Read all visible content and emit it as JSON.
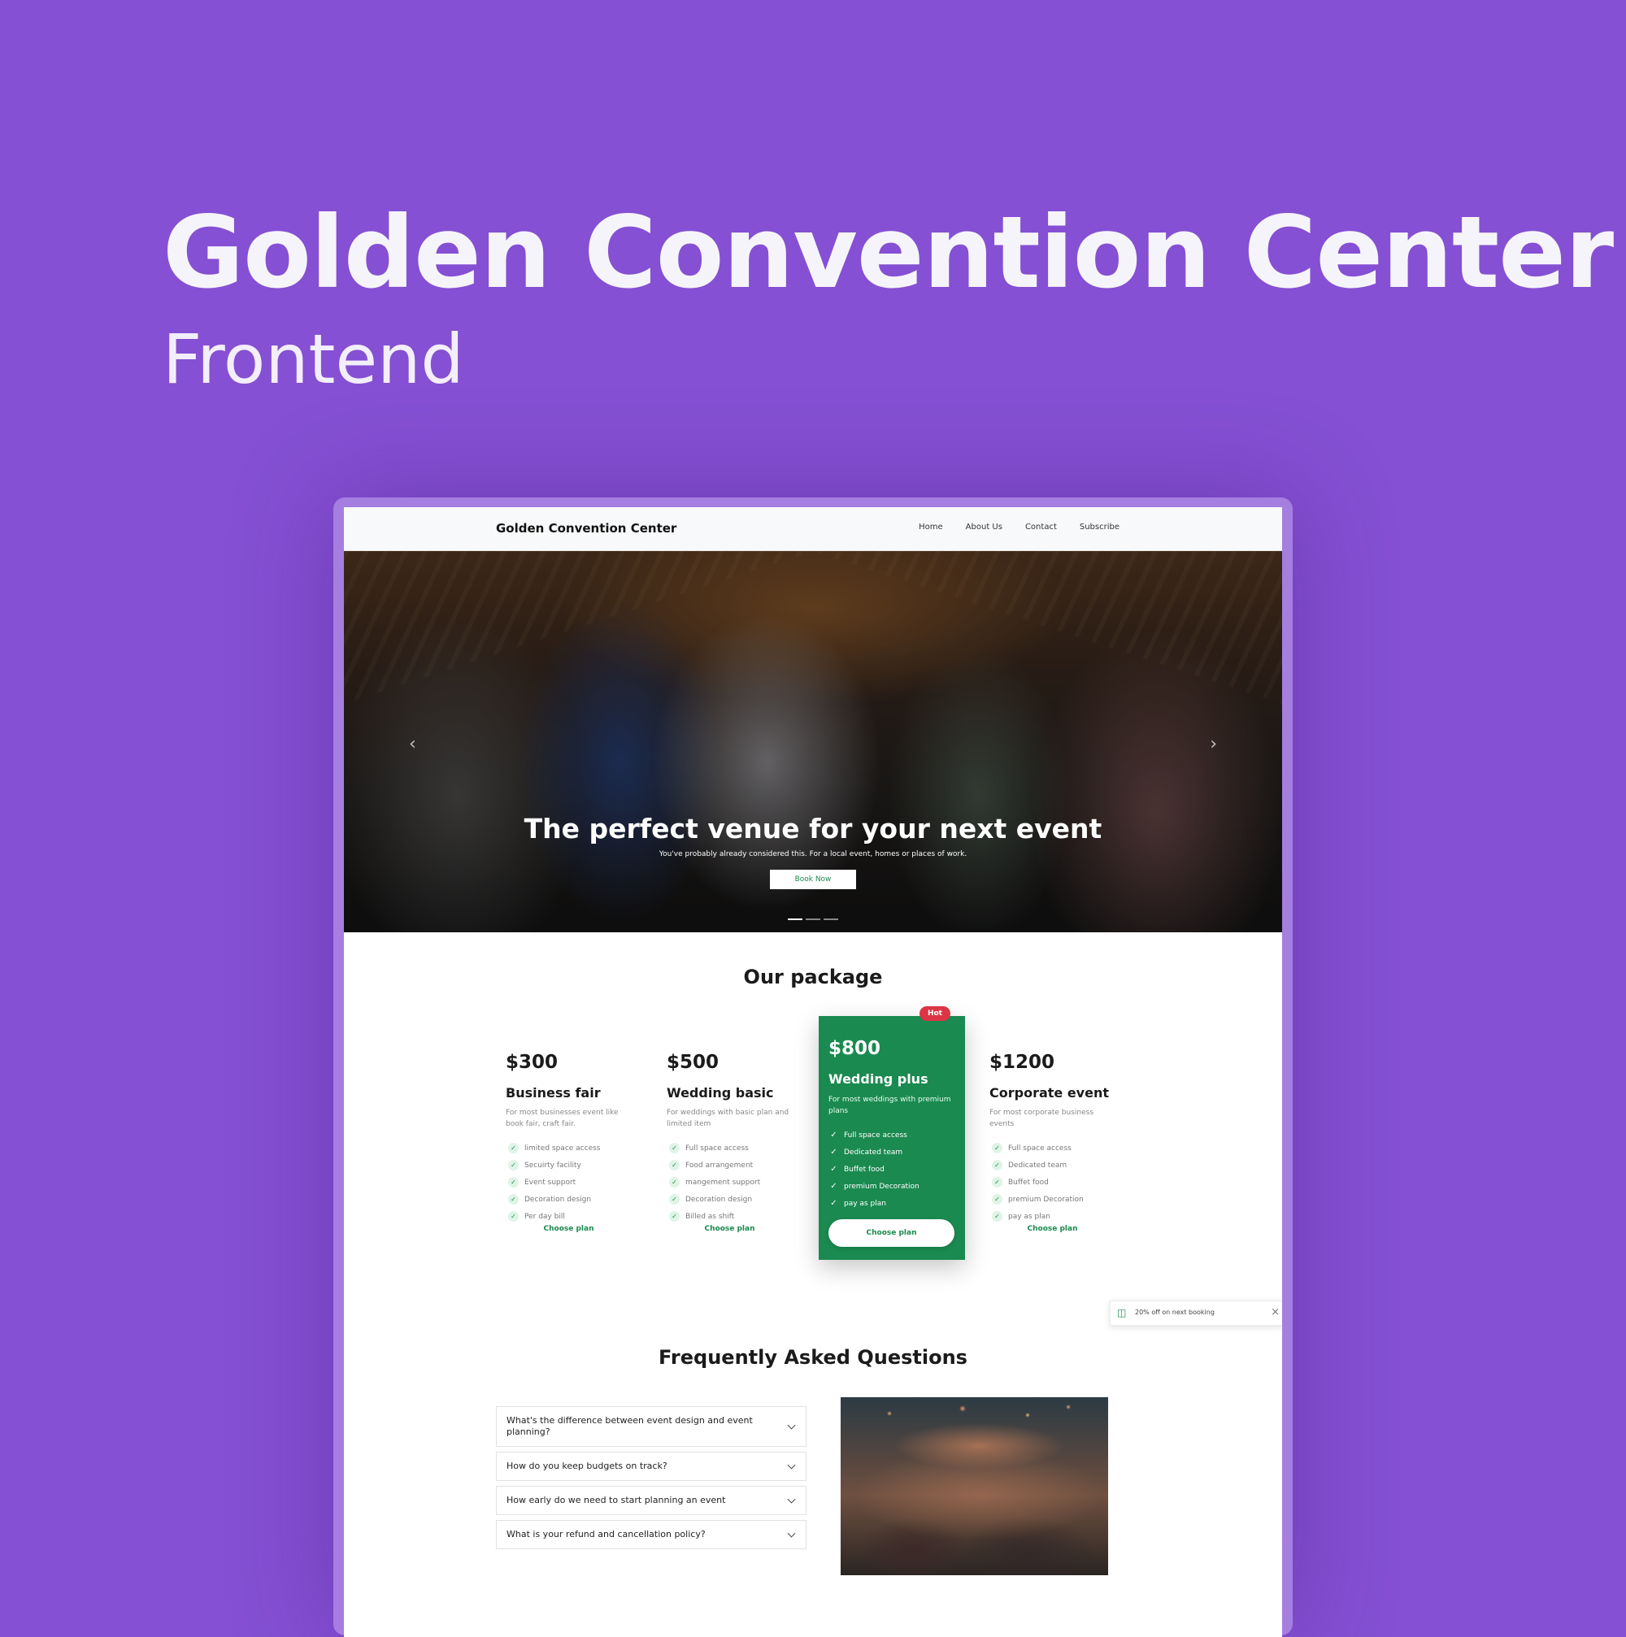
{
  "promo": {
    "title": "Golden Convention Center",
    "subtitle": "Frontend"
  },
  "nav": {
    "brand": "Golden Convention Center",
    "links": [
      "Home",
      "About Us",
      "Contact",
      "Subscribe"
    ]
  },
  "hero": {
    "title": "The perfect venue for your next event",
    "text": "You've probably already considered this. For a local event, homes or places of work.",
    "button": "Book Now",
    "slide_count": 3,
    "active_slide": 1
  },
  "packages": {
    "title": "Our package",
    "items": [
      {
        "price": "$300",
        "name": "Business fair",
        "desc": "For most businesses event like book fair, craft fair.",
        "features": [
          "limited space access",
          "Secuirty facility",
          "Event support",
          "Decoration design",
          "Per day bill"
        ],
        "cta": "Choose plan"
      },
      {
        "price": "$500",
        "name": "Wedding basic",
        "desc": "For weddings with basic plan and limited item",
        "features": [
          "Full space access",
          "Food arrangement",
          "mangement support",
          "Decoration design",
          "Billed as shift"
        ],
        "cta": "Choose plan"
      },
      {
        "price": "$800",
        "name": "Wedding plus",
        "desc": "For most weddings with premium plans",
        "features": [
          "Full space access",
          "Dedicated team",
          "Buffet food",
          "premium Decoration",
          "pay as plan"
        ],
        "cta": "Choose plan",
        "badge": "Hot"
      },
      {
        "price": "$1200",
        "name": "Corporate event",
        "desc": "For most corporate business events",
        "features": [
          "Full space access",
          "Dedicated team",
          "Buffet food",
          "premium Decoration",
          "pay as plan"
        ],
        "cta": "Choose plan"
      }
    ]
  },
  "toast": {
    "text": "20% off on next booking"
  },
  "faq": {
    "title": "Frequently Asked Questions",
    "items": [
      "What's the difference between event design and event planning?",
      "How do you keep budgets on track?",
      "How early do we need to start planning an event",
      "What is your refund and cancellation policy?"
    ]
  },
  "colors": {
    "background": "#8550d3",
    "accent": "#1a8a50",
    "badge": "#dc3545"
  }
}
